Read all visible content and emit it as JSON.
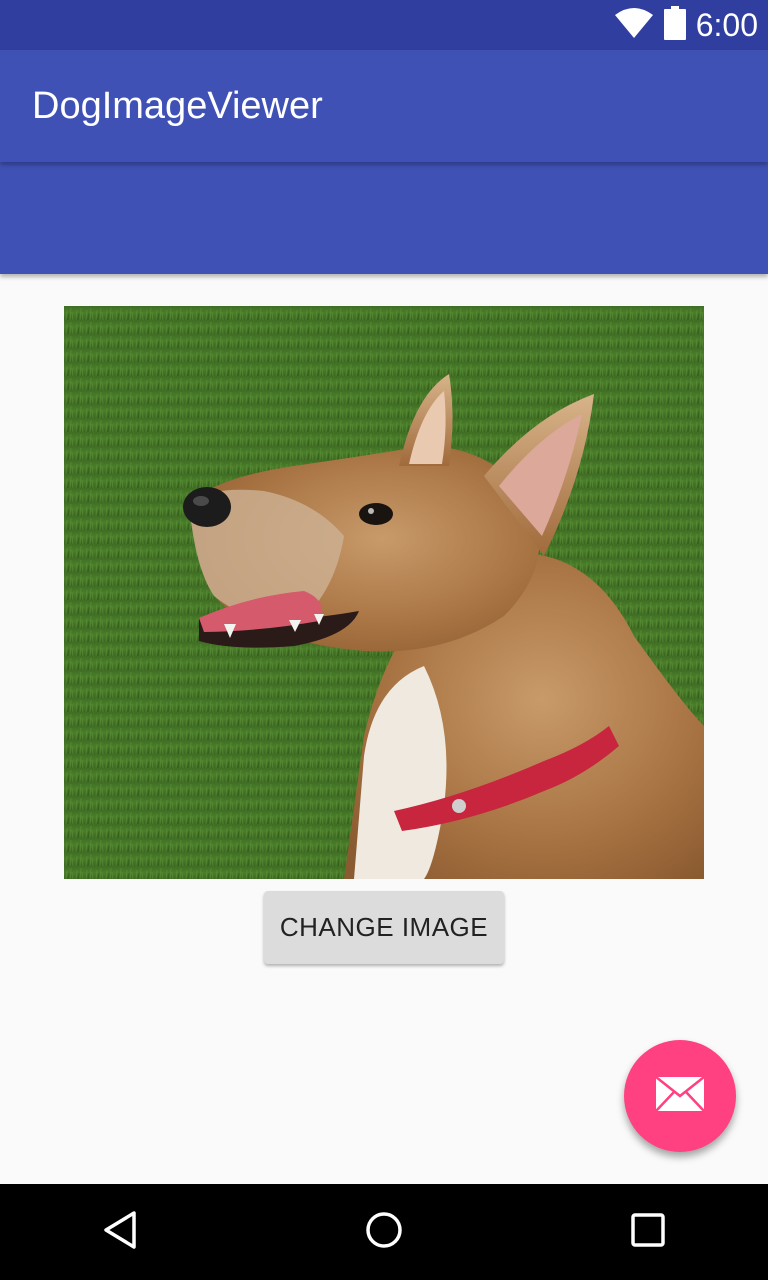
{
  "status_bar": {
    "time": "6:00",
    "icons": [
      "wifi-icon",
      "battery-icon"
    ]
  },
  "toolbar": {
    "title": "DogImageViewer"
  },
  "main": {
    "image": {
      "subject": "dog-photo"
    },
    "change_button_label": "CHANGE IMAGE"
  },
  "fab": {
    "icon": "mail-icon",
    "color": "#ff4081"
  },
  "nav_bar": {
    "items": [
      "back-icon",
      "home-icon",
      "recents-icon"
    ]
  },
  "colors": {
    "primary": "#3f51b5",
    "primary_dark": "#303f9f",
    "accent": "#ff4081",
    "background": "#fafafa"
  }
}
